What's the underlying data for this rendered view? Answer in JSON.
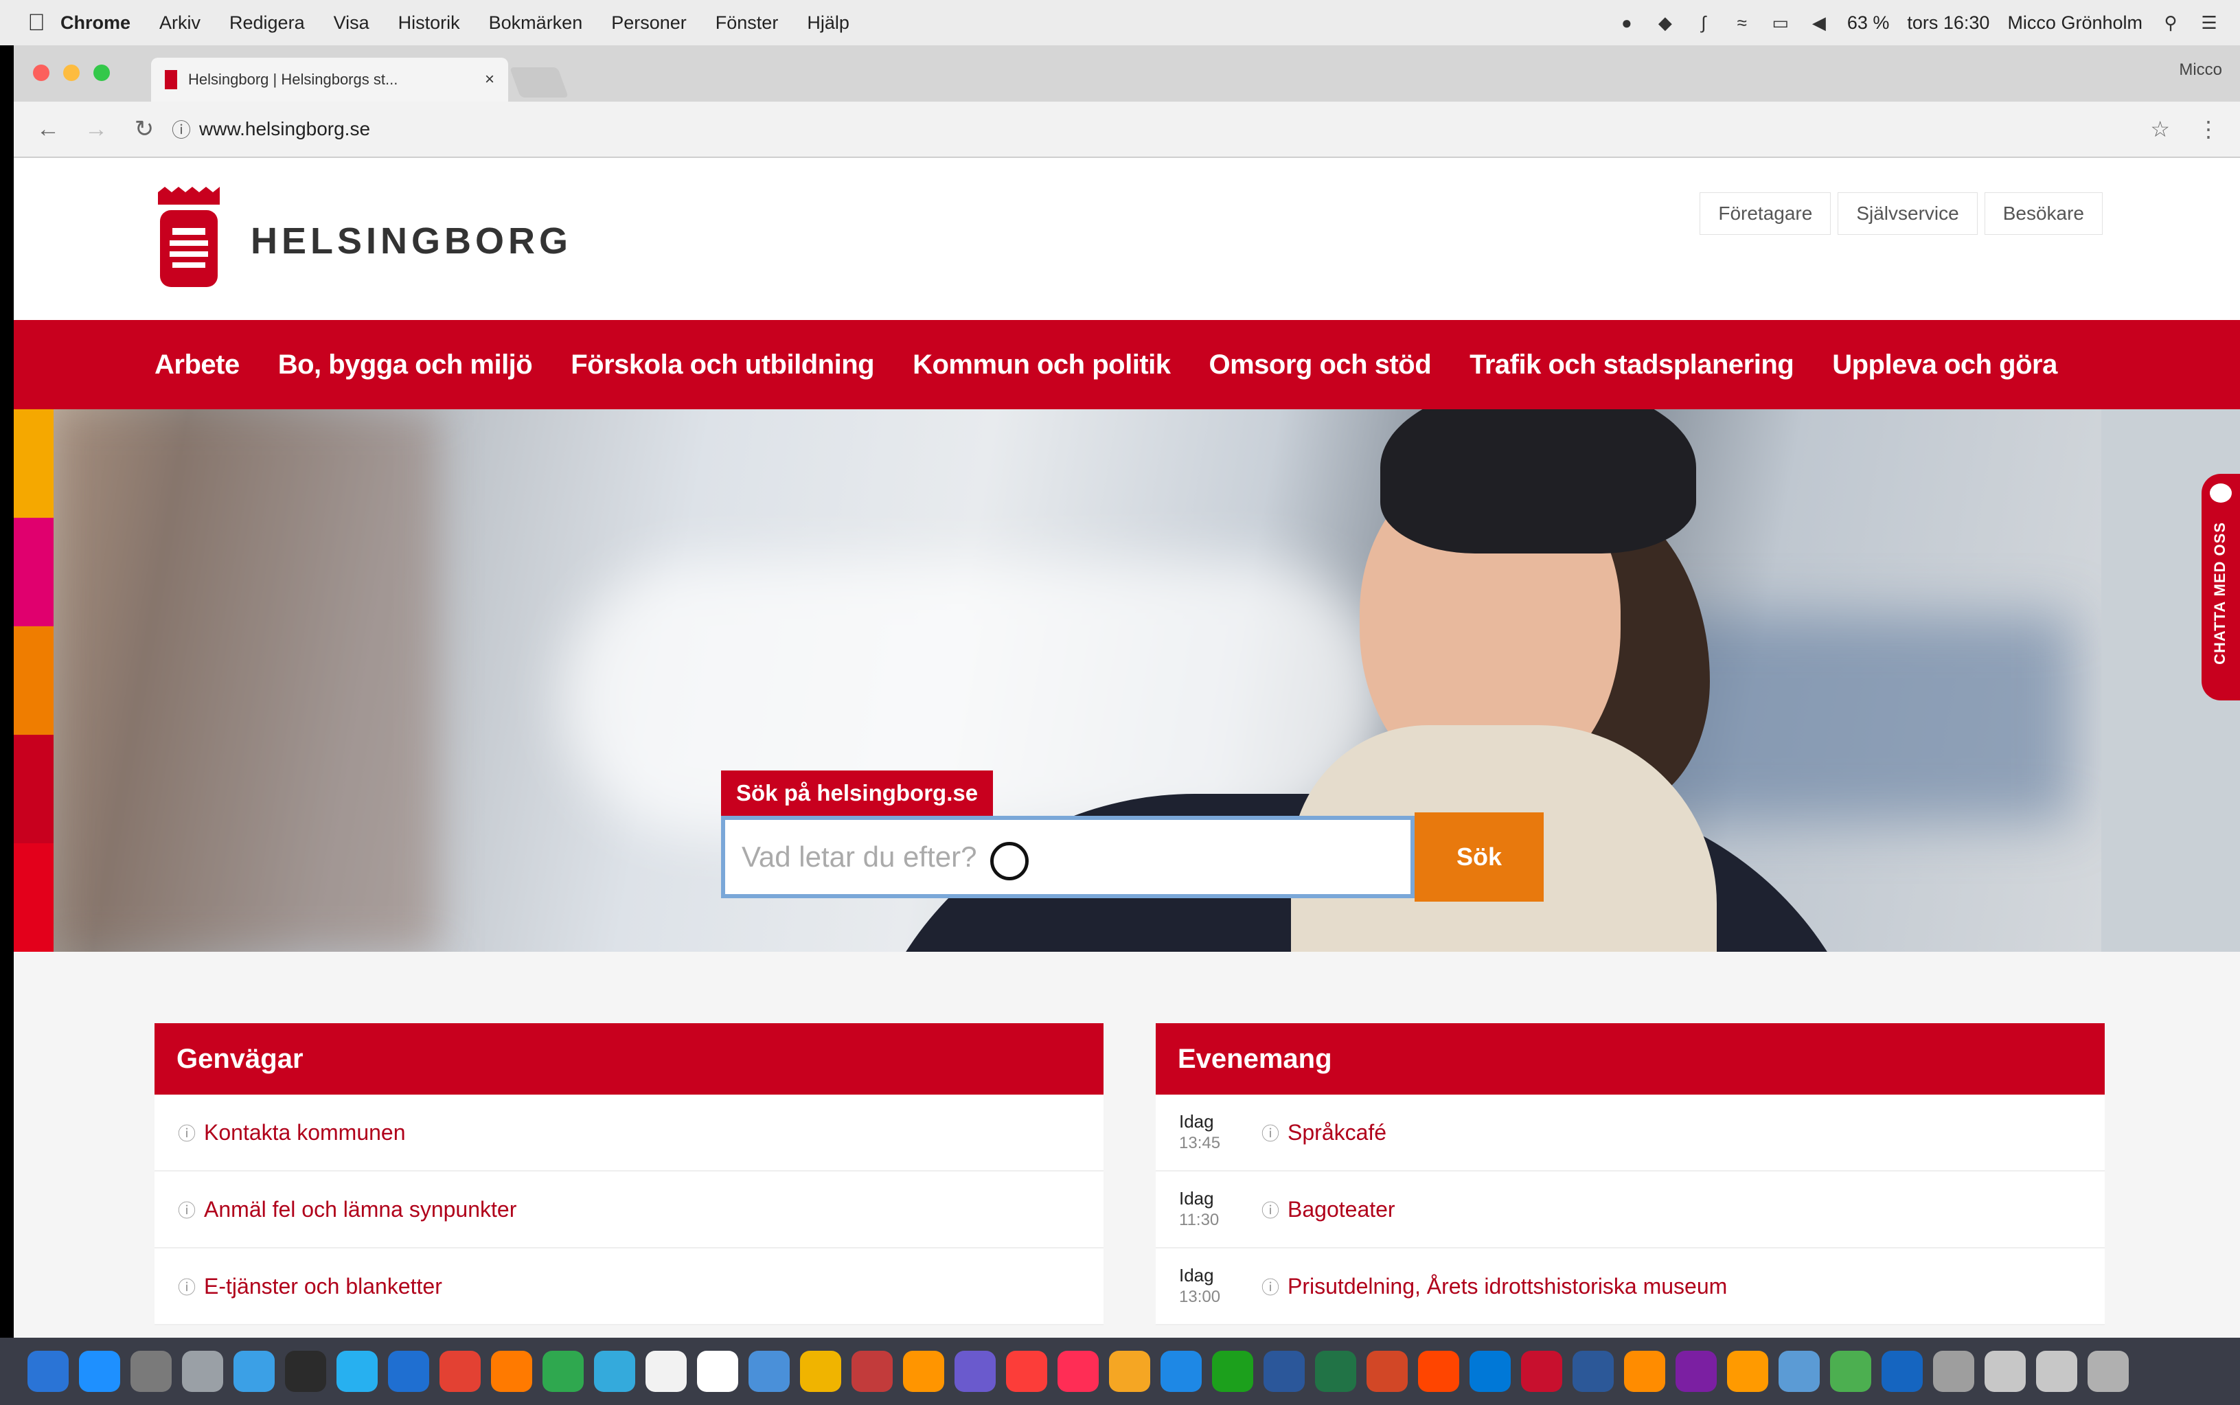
{
  "menubar": {
    "app": "Chrome",
    "items": [
      "Arkiv",
      "Redigera",
      "Visa",
      "Historik",
      "Bokmärken",
      "Personer",
      "Fönster",
      "Hjälp"
    ],
    "battery": "63 %",
    "clock": "tors 16:30",
    "user": "Micco Grönholm"
  },
  "browser": {
    "tab_title": "Helsingborg | Helsingborgs st...",
    "tab_close": "×",
    "profile": "Micco",
    "url": "www.helsingborg.se"
  },
  "site": {
    "brand": "HELSINGBORG",
    "util_links": [
      "Företagare",
      "Självservice",
      "Besökare"
    ],
    "nav": [
      "Arbete",
      "Bo, bygga och miljö",
      "Förskola och utbildning",
      "Kommun och politik",
      "Omsorg och stöd",
      "Trafik och stadsplanering",
      "Uppleva och göra"
    ],
    "search": {
      "title": "Sök på helsingborg.se",
      "placeholder": "Vad letar du efter?",
      "button": "Sök"
    },
    "chat_label": "CHATTA MED OSS",
    "shortcuts": {
      "title": "Genvägar",
      "items": [
        "Kontakta kommunen",
        "Anmäl fel och lämna synpunkter",
        "E-tjänster och blanketter"
      ]
    },
    "events": {
      "title": "Evenemang",
      "items": [
        {
          "day": "Idag",
          "time": "13:45",
          "name": "Språkcafé"
        },
        {
          "day": "Idag",
          "time": "11:30",
          "name": "Bagoteater"
        },
        {
          "day": "Idag",
          "time": "13:00",
          "name": "Prisutdelning, Årets idrottshistoriska museum"
        }
      ]
    }
  },
  "colors": {
    "brand_red": "#c8001e",
    "search_button": "#e8790d",
    "stripes": [
      "#f5a800",
      "#e0006e",
      "#ef7d00",
      "#c8001e",
      "#e3001b"
    ],
    "dock_icons": [
      "#2a74d6",
      "#1e90ff",
      "#7a7a7a",
      "#9aa0a6",
      "#3ba0e6",
      "#2b2b2b",
      "#27b0f0",
      "#1f6fd1",
      "#e34133",
      "#ff7a00",
      "#2fa84f",
      "#34aadc",
      "#f2f2f2",
      "#ffffff",
      "#4a90d9",
      "#f0b400",
      "#c23b3b",
      "#ff9500",
      "#6a5acd",
      "#fc3d39",
      "#ff2d55",
      "#f5a623",
      "#1e88e5",
      "#1ca01c",
      "#2b579a",
      "#217346",
      "#d24726",
      "#ff4500",
      "#0078d7",
      "#c8102e",
      "#2c5898",
      "#ff8c00",
      "#7b1fa2",
      "#ff9a00",
      "#5b9bd5",
      "#4caf50",
      "#1565c0",
      "#9e9e9e",
      "#c7c7c7",
      "#c7c7c7",
      "#b0b0b0"
    ]
  }
}
